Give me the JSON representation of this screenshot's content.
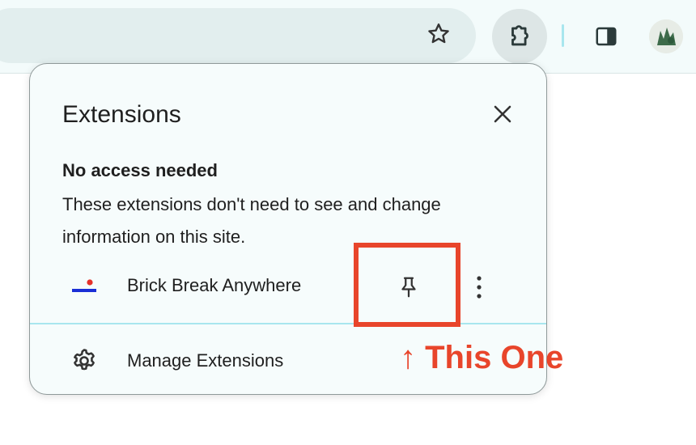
{
  "toolbar": {
    "icons": [
      "star-icon",
      "puzzle-icon",
      "side-panel-icon",
      "avatar"
    ]
  },
  "popup": {
    "title": "Extensions",
    "close_icon": "close-icon",
    "section_heading": "No access needed",
    "section_description": "These extensions don't need to see and change information on this site.",
    "extension": {
      "name": "Brick Break Anywhere",
      "pin_icon": "pin-icon",
      "more_icon": "more-vert-icon"
    },
    "manage_label": "Manage Extensions",
    "manage_icon": "gear-icon"
  },
  "annotation": {
    "text": "↑ This One",
    "color": "#e8452b"
  },
  "colors": {
    "toolbar_bg": "#f3fbfb",
    "omnibox_bg": "#e2eeee",
    "popup_bg": "#f6fcfc",
    "divider": "#a8e6ee",
    "highlight": "#e8452b"
  }
}
